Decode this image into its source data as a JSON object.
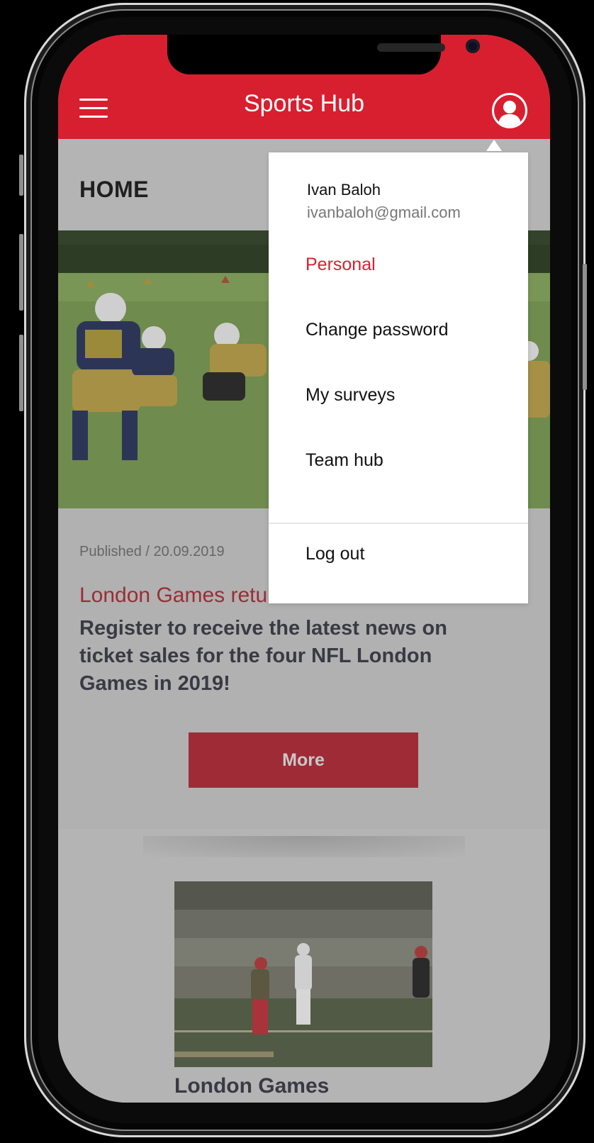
{
  "app": {
    "title": "Sports Hub"
  },
  "page": {
    "title": "HOME"
  },
  "article": {
    "published": "Published / 20.09.2019",
    "title": "London Games return in 2019",
    "body": "Register to receive the latest news on ticket sales for the four NFL London Games in 2019!",
    "more_label": "More"
  },
  "card": {
    "title": "London Games"
  },
  "user": {
    "name": "Ivan Baloh",
    "email": "ivanbaloh@gmail.com"
  },
  "menu": {
    "items": [
      {
        "label": "Personal",
        "active": true
      },
      {
        "label": "Change password",
        "active": false
      },
      {
        "label": "My surveys",
        "active": false
      },
      {
        "label": "Team hub",
        "active": false
      }
    ],
    "logout_label": "Log out"
  },
  "colors": {
    "brand": "#d81f2f",
    "dimmed_button": "#9f2b37"
  },
  "icons": {
    "menu": "hamburger-icon",
    "profile": "user-avatar-icon"
  }
}
